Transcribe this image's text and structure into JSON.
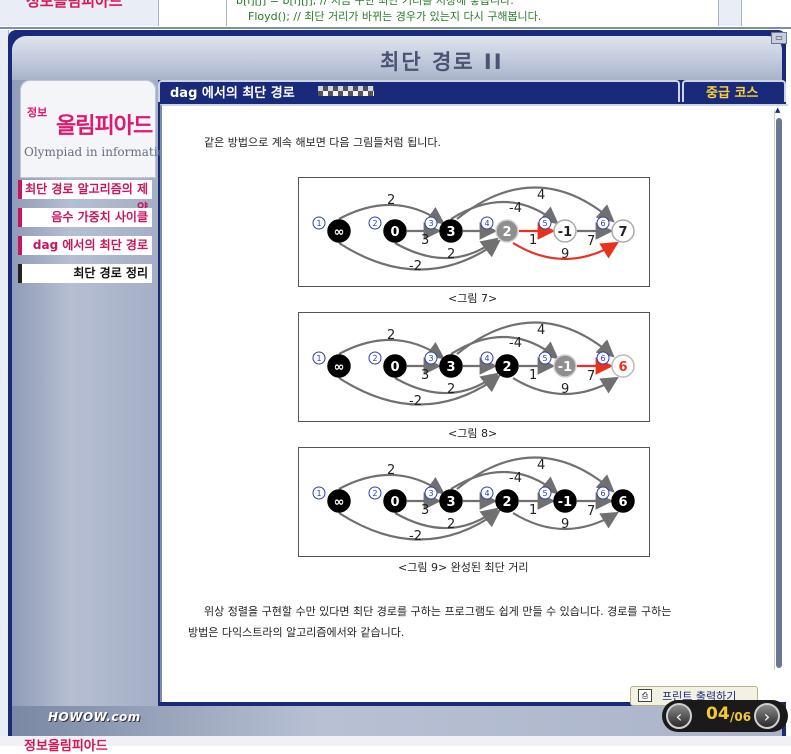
{
  "prev_window": {
    "left_text": "정보올림피아드",
    "code_line1": "b[i][j] = b[i][j]; // 지금 구한 최단 거리를 저장해 놓습니다.",
    "code_line2": "Floyd(); // 최단 거리가 바뀌는 경우가 있는지 다시 구해봅니다."
  },
  "page_title": "최단 경로 II",
  "corner_icon": "window-icon",
  "logo": {
    "small": "정보",
    "main": "올림피아드",
    "english": "Olympiad in informatics"
  },
  "sidebar": {
    "items": [
      {
        "label": "최단 경로 알고리즘의 제약",
        "state": "normal"
      },
      {
        "label": "음수 가중치 사이클",
        "state": "normal"
      },
      {
        "label": "dag 에서의 최단 경로",
        "state": "normal"
      },
      {
        "label": "최단 경로 정리",
        "state": "selected"
      }
    ]
  },
  "section_title": "dag 에서의 최단 경로",
  "course_label": "중급 코스",
  "intro_text": "같은 방법으로 계속 해보면 다음 그림들처럼 됩니다.",
  "figures": [
    {
      "caption": "<그림 7>",
      "nodes": [
        {
          "index": "1",
          "value": "∞",
          "style": "black"
        },
        {
          "index": "2",
          "value": "0",
          "style": "black"
        },
        {
          "index": "3",
          "value": "3",
          "style": "black"
        },
        {
          "index": "4",
          "value": "2",
          "style": "gray"
        },
        {
          "index": "5",
          "value": "-1",
          "style": "white"
        },
        {
          "index": "6",
          "value": "7",
          "style": "white"
        }
      ],
      "edge_labels": [
        "2",
        "3",
        "2",
        "-4",
        "4",
        "1",
        "7",
        "9",
        "-2"
      ]
    },
    {
      "caption": "<그림 8>",
      "nodes": [
        {
          "index": "1",
          "value": "∞",
          "style": "black"
        },
        {
          "index": "2",
          "value": "0",
          "style": "black"
        },
        {
          "index": "3",
          "value": "3",
          "style": "black"
        },
        {
          "index": "4",
          "value": "2",
          "style": "black"
        },
        {
          "index": "5",
          "value": "-1",
          "style": "gray"
        },
        {
          "index": "6",
          "value": "6",
          "style": "white-red"
        }
      ],
      "edge_labels": [
        "2",
        "3",
        "2",
        "-4",
        "4",
        "1",
        "7",
        "9",
        "-2"
      ]
    },
    {
      "caption": "<그림 9> 완성된 최단 거리",
      "nodes": [
        {
          "index": "1",
          "value": "∞",
          "style": "black"
        },
        {
          "index": "2",
          "value": "0",
          "style": "black"
        },
        {
          "index": "3",
          "value": "3",
          "style": "black"
        },
        {
          "index": "4",
          "value": "2",
          "style": "black"
        },
        {
          "index": "5",
          "value": "-1",
          "style": "black"
        },
        {
          "index": "6",
          "value": "6",
          "style": "black"
        }
      ],
      "edge_labels": [
        "2",
        "3",
        "2",
        "-4",
        "4",
        "1",
        "7",
        "9",
        "-2"
      ]
    }
  ],
  "outro_line1": "위상 정렬을 구현할 수만 있다면 최단 경로를 구하는 프로그램도 쉽게 만들 수 있습니다. 경로를 구하는",
  "outro_line2": "방법은 다익스트라의 알고리즘에서와 같습니다.",
  "print_button_label": "프린트 출력하기",
  "brand": "HOWOW.com",
  "pagination": {
    "current": "04",
    "total": "/06",
    "prev_icon": "chevron-left-icon",
    "next_icon": "chevron-right-icon"
  },
  "colors": {
    "accent_pink": "#c8155e",
    "navy": "#1a2a7a",
    "gold": "#f4c930",
    "highlight_edge": "#e8321e"
  }
}
